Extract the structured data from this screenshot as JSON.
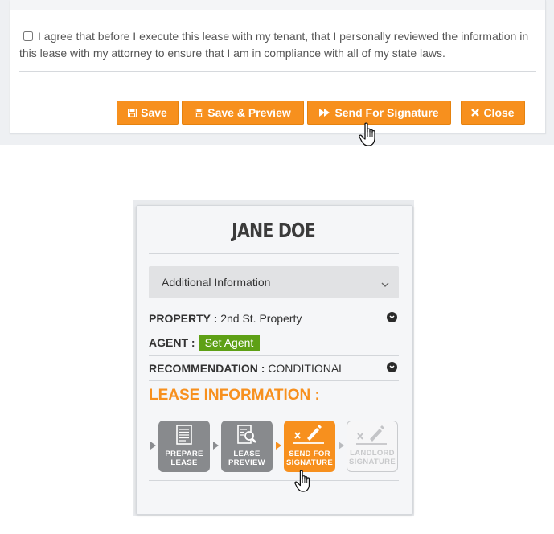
{
  "agreement": {
    "text": "I agree that before I execute this lease with my tenant, that I personally reviewed the information in this lease with my attorney to ensure that I am in compliance with all of my state laws.",
    "checked": false
  },
  "buttons": {
    "save": "Save",
    "save_preview": "Save & Preview",
    "send": "Send For Signature",
    "close": "Close"
  },
  "tenant": {
    "name": "JANE DOE",
    "accordion_label": "Additional Information",
    "property_label": "PROPERTY :",
    "property_value": "2nd St. Property",
    "agent_label": "AGENT :",
    "agent_button": "Set Agent",
    "recommendation_label": "RECOMMENDATION :",
    "recommendation_value": "CONDITIONAL",
    "lease_title": "LEASE INFORMATION :"
  },
  "steps": [
    {
      "line1": "PREPARE",
      "line2": "LEASE",
      "icon": "document-icon",
      "state": "done"
    },
    {
      "line1": "LEASE",
      "line2": "PREVIEW",
      "icon": "magnify-document-icon",
      "state": "done"
    },
    {
      "line1": "SEND FOR",
      "line2": "SIGNATURE",
      "icon": "signature-pen-icon",
      "state": "active"
    },
    {
      "line1": "LANDLORD",
      "line2": "SIGNATURE",
      "icon": "signature-pen-icon",
      "state": "pending"
    }
  ],
  "colors": {
    "accent": "#f7901e",
    "agent_green": "#5ea015",
    "step_done": "#888a8d"
  }
}
